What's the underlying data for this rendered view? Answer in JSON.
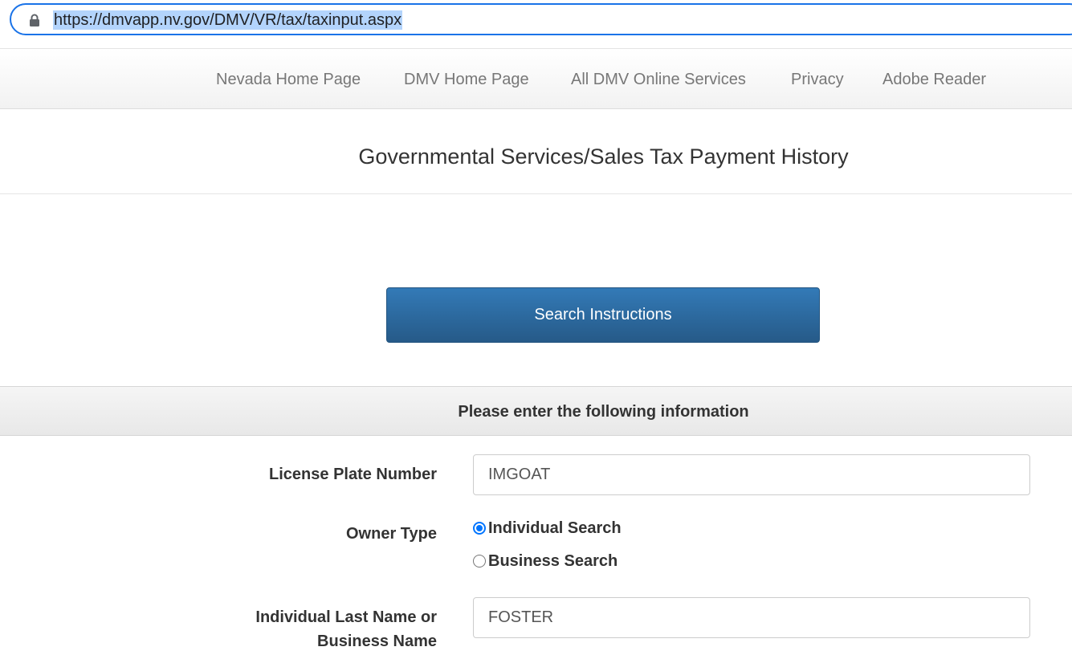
{
  "browser": {
    "url": "https://dmvapp.nv.gov/DMV/VR/tax/taxinput.aspx",
    "lock_icon": "lock-icon"
  },
  "nav": {
    "links": [
      "Nevada Home Page",
      "DMV Home Page",
      "All DMV Online Services",
      "Privacy",
      "Adobe Reader"
    ]
  },
  "page": {
    "title": "Governmental Services/Sales Tax Payment History",
    "search_button": "Search Instructions",
    "section_header": "Please enter the following information"
  },
  "form": {
    "plate_label": "License Plate Number",
    "plate_value": "IMGOAT",
    "owner_type_label": "Owner Type",
    "owner_options": [
      {
        "label": "Individual Search",
        "selected": true
      },
      {
        "label": "Business Search",
        "selected": false
      }
    ],
    "name_label_line1": "Individual Last Name or",
    "name_label_line2": "Business Name",
    "name_value": "FOSTER"
  },
  "colors": {
    "url_focus": "#1a73e8",
    "button_primary": "#2c6aa3",
    "radio_checked": "#0075ff"
  }
}
